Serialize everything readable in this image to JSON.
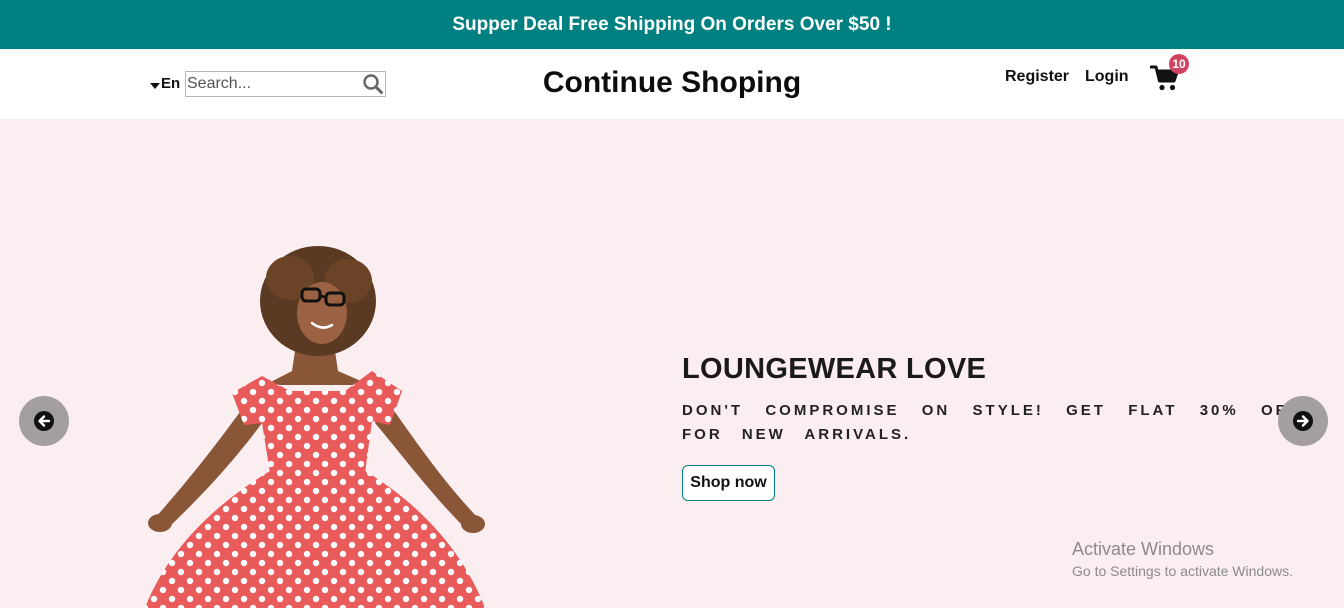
{
  "announcement": {
    "text": "Supper Deal Free Shipping On Orders Over $50 !"
  },
  "navbar": {
    "language": "En",
    "search": {
      "placeholder": "Search...",
      "value": ""
    },
    "brand": "Continue Shoping",
    "register_label": "Register",
    "login_label": "Login",
    "cart_count": "10"
  },
  "hero": {
    "title": "LOUNGEWEAR LOVE",
    "description": "DON'T COMPROMISE ON STYLE! GET FLAT 30% OFF FOR NEW ARRIVALS.",
    "button_label": "Shop now",
    "image_alt": "woman in red polka dot dress"
  },
  "watermark": {
    "line1": "Activate Windows",
    "line2": "Go to Settings to activate Windows."
  },
  "colors": {
    "announcement_bg": "#008080",
    "hero_bg": "#fbeef1",
    "badge": "#d24362",
    "dress": "#e95a5a"
  },
  "icons": {
    "search": "search-icon",
    "cart": "cart-icon",
    "prev": "arrow-left-icon",
    "next": "arrow-right-icon",
    "language_caret": "caret-down-icon"
  }
}
